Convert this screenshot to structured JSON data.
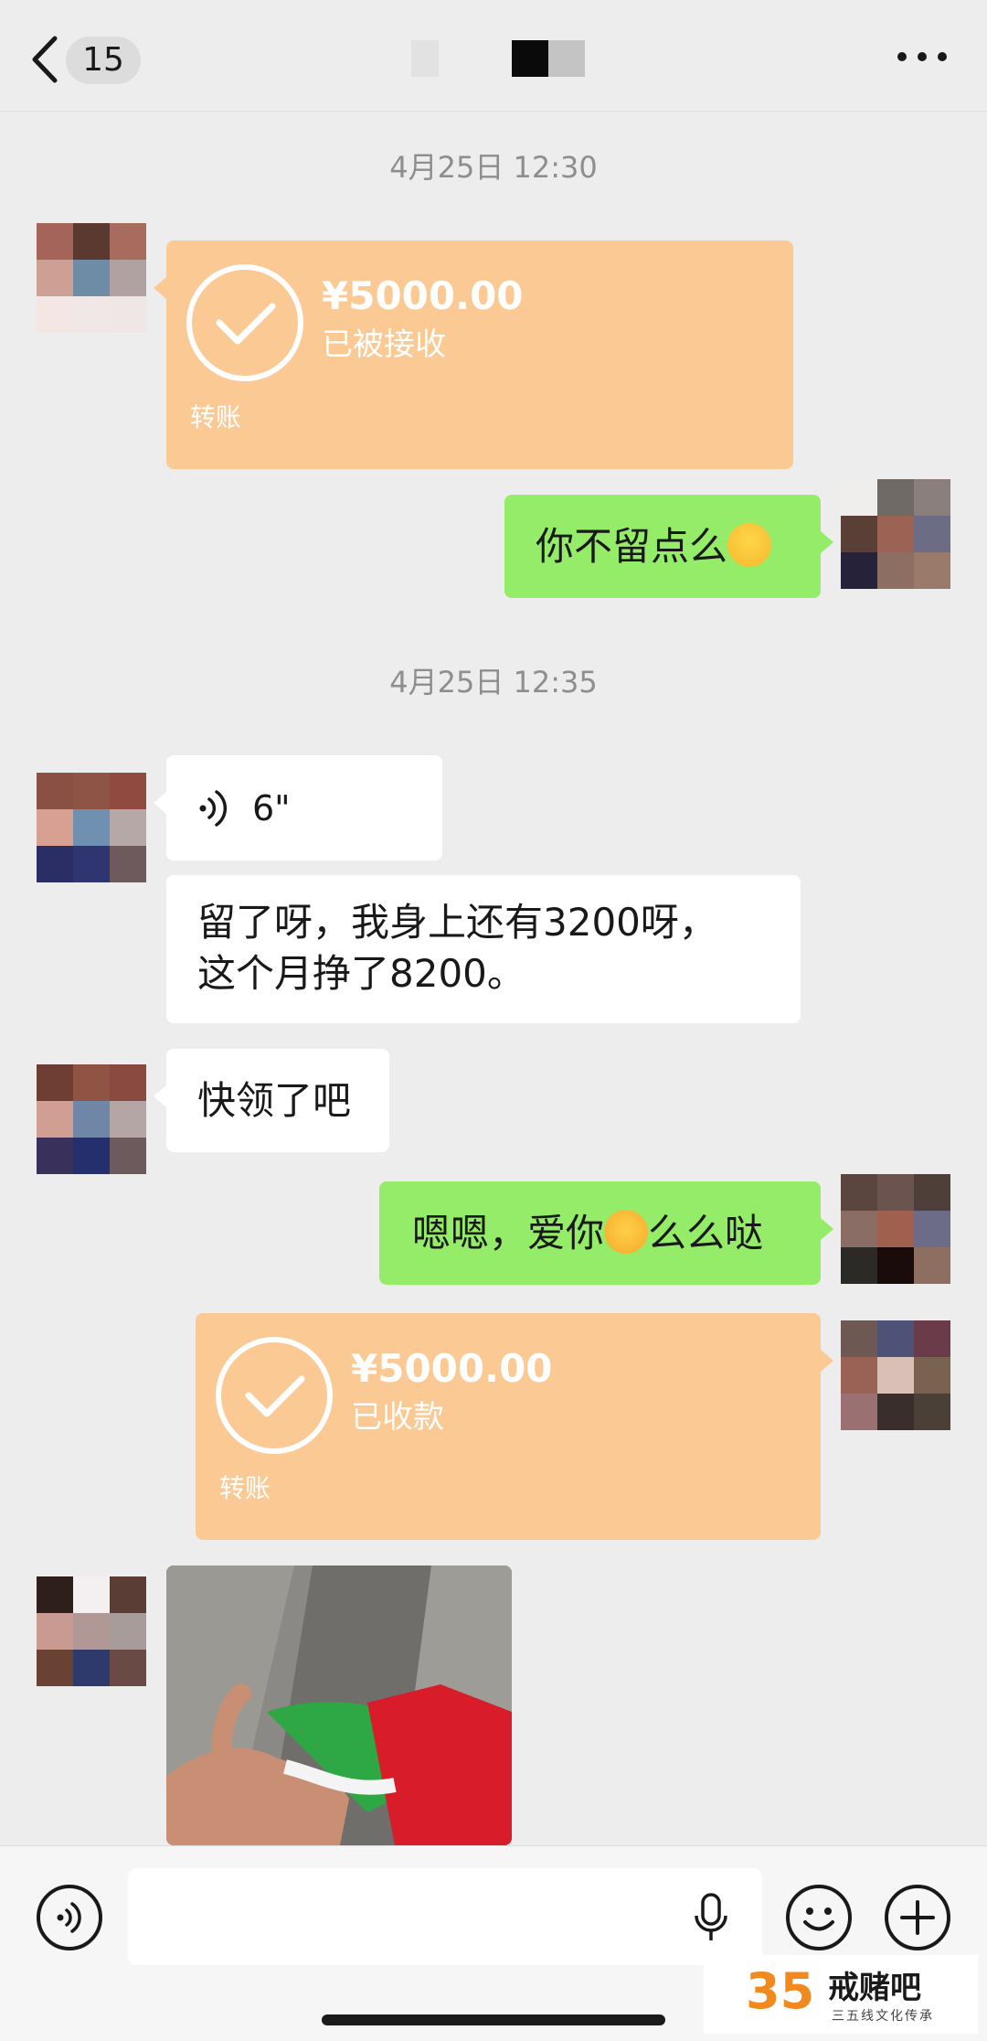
{
  "header": {
    "back_icon": "chevron-left-icon",
    "unread_count": "15",
    "more_icon": "ellipsis-icon"
  },
  "timestamps": [
    "4月25日 12:30",
    "4月25日 12:35"
  ],
  "messages": {
    "transfer_received": {
      "amount": "¥5000.00",
      "status": "已被接收",
      "label": "转账"
    },
    "me_text_1": "你不留点么",
    "voice": {
      "duration": "6\"",
      "icon": "voice-wave-icon"
    },
    "them_text_1_line1": "留了呀，我身上还有3200呀，",
    "them_text_1_line2": "这个月挣了8200。",
    "them_text_2": "快领了吧",
    "me_text_2_part1": "嗯嗯，爱你",
    "me_text_2_part2": "么么哒",
    "transfer_collected": {
      "amount": "¥5000.00",
      "status": "已收款",
      "label": "转账"
    }
  },
  "input_bar": {
    "voice_icon": "voice-mode-icon",
    "mic_icon": "microphone-icon",
    "emoji_icon": "smiley-icon",
    "plus_icon": "plus-icon",
    "placeholder": ""
  },
  "watermark": {
    "number": "35",
    "title": "戒赌吧",
    "subtitle": "三五线文化传承"
  },
  "colors": {
    "background": "#ededed",
    "green_bubble": "#95ec69",
    "white_bubble": "#ffffff",
    "transfer_bubble": "#fbc993"
  }
}
